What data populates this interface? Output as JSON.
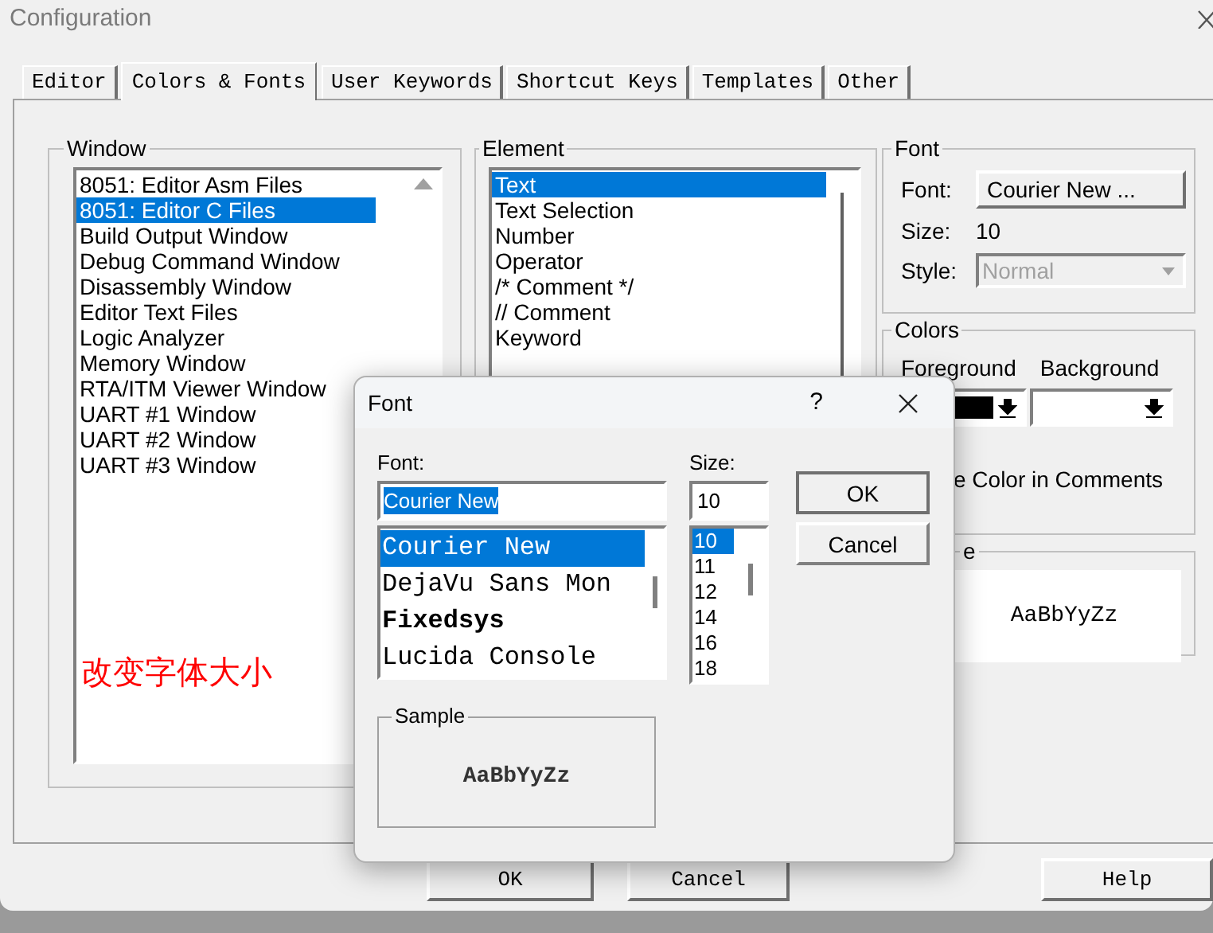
{
  "window": {
    "title": "Configuration"
  },
  "tabs": [
    {
      "label": "Editor",
      "selected": false
    },
    {
      "label": "Colors & Fonts",
      "selected": true
    },
    {
      "label": "User Keywords",
      "selected": false
    },
    {
      "label": "Shortcut Keys",
      "selected": false
    },
    {
      "label": "Templates",
      "selected": false
    },
    {
      "label": "Other",
      "selected": false
    }
  ],
  "window_group": {
    "label": "Window",
    "items": [
      {
        "label": "8051: Editor Asm Files",
        "selected": false
      },
      {
        "label": "8051: Editor C Files",
        "selected": true
      },
      {
        "label": "Build Output Window",
        "selected": false
      },
      {
        "label": "Debug Command Window",
        "selected": false
      },
      {
        "label": "Disassembly Window",
        "selected": false
      },
      {
        "label": "Editor Text Files",
        "selected": false
      },
      {
        "label": "Logic Analyzer",
        "selected": false
      },
      {
        "label": "Memory Window",
        "selected": false
      },
      {
        "label": "RTA/ITM Viewer Window",
        "selected": false
      },
      {
        "label": "UART #1 Window",
        "selected": false
      },
      {
        "label": "UART #2 Window",
        "selected": false
      },
      {
        "label": "UART #3 Window",
        "selected": false
      }
    ],
    "annotation": "改变字体大小"
  },
  "element_group": {
    "label": "Element",
    "items": [
      {
        "label": "Text",
        "selected": true
      },
      {
        "label": "Text Selection",
        "selected": false
      },
      {
        "label": "Number",
        "selected": false
      },
      {
        "label": "Operator",
        "selected": false
      },
      {
        "label": "/* Comment */",
        "selected": false
      },
      {
        "label": "// Comment",
        "selected": false
      },
      {
        "label": "Keyword",
        "selected": false
      }
    ]
  },
  "font_group": {
    "label": "Font",
    "font_label": "Font:",
    "font_button": "Courier New ...",
    "size_label": "Size:",
    "size_value": "10",
    "style_label": "Style:",
    "style_value": "Normal",
    "style_disabled": true
  },
  "colors_group": {
    "label": "Colors",
    "foreground_label": "Foreground",
    "background_label": "Background",
    "comments_option": "e Color in Comments"
  },
  "sample_group": {
    "label": "e",
    "text": "AaBbYyZz"
  },
  "buttons": [
    "OK",
    "Cancel",
    "Help"
  ],
  "font_dialog": {
    "title": "Font",
    "help": "?",
    "font_label": "Font:",
    "font_value": "Courier New",
    "fonts": [
      {
        "label": "Courier New",
        "selected": true,
        "bold": false
      },
      {
        "label": "DejaVu Sans Mon",
        "selected": false,
        "bold": false
      },
      {
        "label": "Fixedsys",
        "selected": false,
        "bold": true
      },
      {
        "label": "Lucida Console",
        "selected": false,
        "bold": false
      }
    ],
    "size_label": "Size:",
    "size_value": "10",
    "sizes": [
      {
        "label": "10",
        "selected": true
      },
      {
        "label": "11",
        "selected": false
      },
      {
        "label": "12",
        "selected": false
      },
      {
        "label": "14",
        "selected": false
      },
      {
        "label": "16",
        "selected": false
      },
      {
        "label": "18",
        "selected": false
      }
    ],
    "ok": "OK",
    "cancel": "Cancel",
    "sample_label": "Sample",
    "sample_text": "AaBbYyZz"
  }
}
